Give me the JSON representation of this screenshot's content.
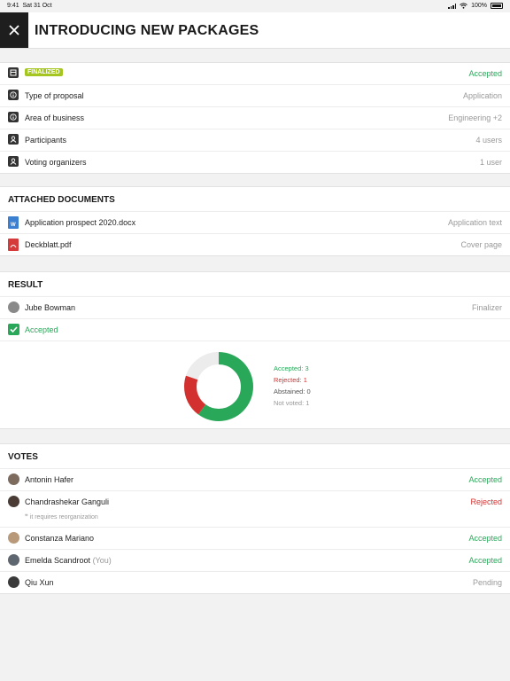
{
  "status_bar": {
    "time": "9:41",
    "date": "Sat 31 Oct",
    "battery": "100%"
  },
  "header": {
    "title": "INTRODUCING NEW PACKAGES"
  },
  "details": [
    {
      "icon": "list-icon",
      "badge": "FINALIZED",
      "value": "Accepted",
      "value_color": "#2aa85a"
    },
    {
      "icon": "info-icon",
      "label": "Type of proposal",
      "value": "Application"
    },
    {
      "icon": "info-icon",
      "label": "Area of business",
      "value": "Engineering +2"
    },
    {
      "icon": "person-icon",
      "label": "Participants",
      "value": "4 users"
    },
    {
      "icon": "person-icon",
      "label": "Voting organizers",
      "value": "1 user"
    }
  ],
  "documents": {
    "title": "ATTACHED DOCUMENTS",
    "items": [
      {
        "icon": "word-document-icon",
        "name": "Application prospect 2020.docx",
        "type": "Application text"
      },
      {
        "icon": "pdf-document-icon",
        "name": "Deckblatt.pdf",
        "type": "Cover page"
      }
    ]
  },
  "result": {
    "title": "RESULT",
    "finalizer_name": "Jube Bowman",
    "finalizer_role": "Finalizer",
    "outcome": "Accepted"
  },
  "chart_data": {
    "type": "pie",
    "categories": [
      "Accepted",
      "Rejected",
      "Abstained",
      "Not voted"
    ],
    "values": [
      3,
      1,
      0,
      1
    ],
    "colors": [
      "#2aa85a",
      "#d3312f",
      "#555555",
      "#e6e6e6"
    ],
    "legend": [
      "Accepted: 3",
      "Rejected: 1",
      "Abstained: 0",
      "Not voted: 1"
    ],
    "legend_placement": "right"
  },
  "votes": {
    "title": "VOTES",
    "items": [
      {
        "name": "Antonin Hafer",
        "you": "",
        "status": "Accepted",
        "status_color": "#2aa85a"
      },
      {
        "name": "Chandrashekar Ganguli",
        "you": "",
        "status": "Rejected",
        "status_color": "#d3312f",
        "comment": "it requires reorganization"
      },
      {
        "name": "Constanza Mariano",
        "you": "",
        "status": "Accepted",
        "status_color": "#2aa85a"
      },
      {
        "name": "Emelda Scandroot",
        "you": "(You)",
        "status": "Accepted",
        "status_color": "#2aa85a"
      },
      {
        "name": "Qiu Xun",
        "you": "",
        "status": "Pending",
        "status_color": "#999999"
      }
    ]
  }
}
